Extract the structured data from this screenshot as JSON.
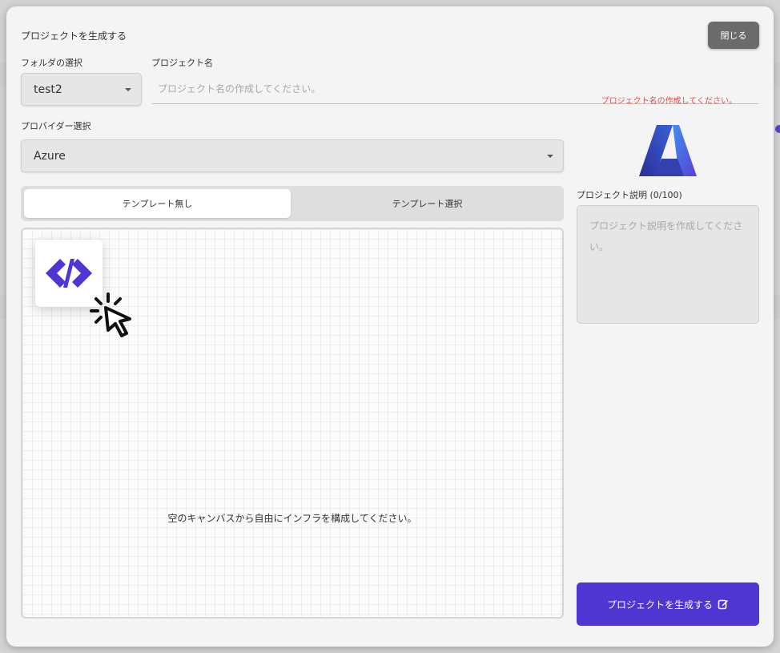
{
  "modal": {
    "title": "プロジェクトを生成する",
    "close_label": "閉じる"
  },
  "folder": {
    "label": "フォルダの選択",
    "value": "test2"
  },
  "project_name": {
    "label": "プロジェクト名",
    "placeholder": "プロジェクト名の作成してください。",
    "error": "プロジェクト名の作成してください。"
  },
  "provider": {
    "label": "プロバイダー選択",
    "value": "Azure",
    "logo_icon": "azure-logo"
  },
  "tabs": [
    {
      "label": "テンプレート無し",
      "active": true
    },
    {
      "label": "テンプレート選択",
      "active": false
    }
  ],
  "canvas": {
    "message": "空のキャンバスから自由にインフラを構成してください。",
    "tile_icon": "code-brackets-icon",
    "cursor_icon": "click-cursor-icon"
  },
  "description": {
    "label": "プロジェクト説明 (0/100)",
    "placeholder": "プロジェクト説明を作成してください。"
  },
  "generate": {
    "label": "プロジェクトを生成する",
    "icon": "edit-icon"
  },
  "colors": {
    "accent": "#4f35d2",
    "error": "#d9534f",
    "close_button": "#6b6b6b"
  }
}
